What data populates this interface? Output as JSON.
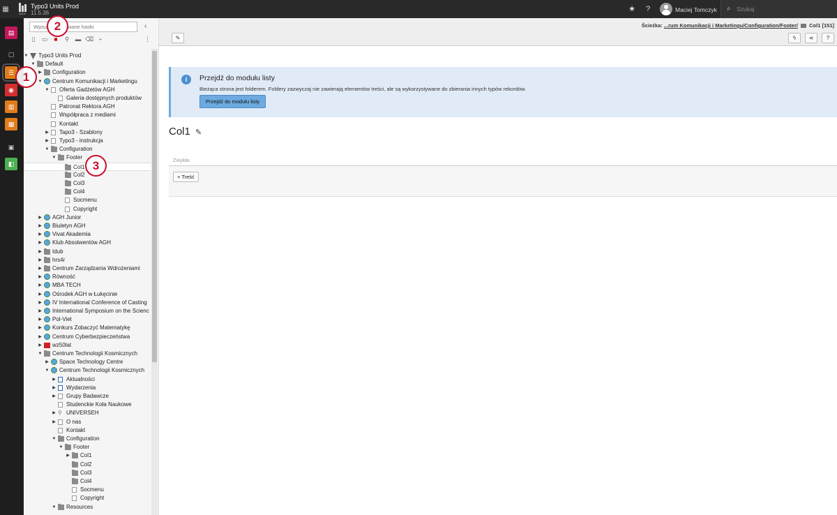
{
  "topbar": {
    "site_name": "Typo3 Units Prod",
    "site_version": "11.5.36",
    "logo_text": "AGH",
    "user_name": "Maciej Tomczyk",
    "search_placeholder": "Szukaj"
  },
  "modules": [
    {
      "name": "web-layout-module",
      "color": "#c2185b"
    },
    {
      "name": "page-module",
      "color": "transparent"
    },
    {
      "name": "list-module",
      "color": "#e07c1a"
    },
    {
      "name": "view-module",
      "color": "#d32f2f"
    },
    {
      "name": "info-module",
      "color": "#e07c1a"
    },
    {
      "name": "calendar-module",
      "color": "#e07c1a"
    },
    {
      "name": "filelist-module",
      "color": "transparent"
    },
    {
      "name": "extension-module",
      "color": "#4caf50"
    }
  ],
  "tree": {
    "filter_placeholder": "Wpisz wyszukiwane hasło",
    "nodes": [
      {
        "label": "Typo3 Units Prod",
        "indent": 0,
        "icon": "root",
        "toggle": "▼"
      },
      {
        "label": "Default",
        "indent": 1,
        "icon": "folder",
        "toggle": "▼"
      },
      {
        "label": "Configuration",
        "indent": 2,
        "icon": "folder",
        "toggle": "▶"
      },
      {
        "label": "Centrum Komunikacji i Marketingu",
        "indent": 2,
        "icon": "site",
        "toggle": "▼"
      },
      {
        "label": "Oferta Gadżetów AGH",
        "indent": 3,
        "icon": "page",
        "toggle": "▼"
      },
      {
        "label": "Galeria dostępnych produktów",
        "indent": 4,
        "icon": "page",
        "toggle": ""
      },
      {
        "label": "Patronat Rektora AGH",
        "indent": 3,
        "icon": "page",
        "toggle": ""
      },
      {
        "label": "Współpraca z mediami",
        "indent": 3,
        "icon": "page",
        "toggle": ""
      },
      {
        "label": "Kontakt",
        "indent": 3,
        "icon": "page",
        "toggle": ""
      },
      {
        "label": "Tapo3 - Szablony",
        "indent": 3,
        "icon": "page",
        "toggle": "▶"
      },
      {
        "label": "Typo3 - instrukcja",
        "indent": 3,
        "icon": "page",
        "toggle": "▶"
      },
      {
        "label": "Configuration",
        "indent": 3,
        "icon": "folder",
        "toggle": "▼"
      },
      {
        "label": "Footer",
        "indent": 4,
        "icon": "folder",
        "toggle": "▼"
      },
      {
        "label": "Col1",
        "indent": 5,
        "icon": "folder",
        "toggle": "",
        "selected": true
      },
      {
        "label": "Col2",
        "indent": 5,
        "icon": "folder",
        "toggle": ""
      },
      {
        "label": "Col3",
        "indent": 5,
        "icon": "folder",
        "toggle": ""
      },
      {
        "label": "Col4",
        "indent": 5,
        "icon": "folder",
        "toggle": ""
      },
      {
        "label": "Socmenu",
        "indent": 5,
        "icon": "page",
        "toggle": ""
      },
      {
        "label": "Copyright",
        "indent": 5,
        "icon": "page",
        "toggle": ""
      },
      {
        "label": "AGH Junior",
        "indent": 2,
        "icon": "site",
        "toggle": "▶"
      },
      {
        "label": "Biuletyn AGH",
        "indent": 2,
        "icon": "site",
        "toggle": "▶"
      },
      {
        "label": "Vivat Akademia",
        "indent": 2,
        "icon": "site",
        "toggle": "▶"
      },
      {
        "label": "Klub Absolwentów AGH",
        "indent": 2,
        "icon": "site",
        "toggle": "▶"
      },
      {
        "label": "Idub",
        "indent": 2,
        "icon": "folder",
        "toggle": "▶"
      },
      {
        "label": "hrs4r",
        "indent": 2,
        "icon": "folder",
        "toggle": "▶"
      },
      {
        "label": "Centrum Zarządzania Wdrożeniami",
        "indent": 2,
        "icon": "folder",
        "toggle": "▶"
      },
      {
        "label": "Równość",
        "indent": 2,
        "icon": "site",
        "toggle": "▶"
      },
      {
        "label": "MBA TECH",
        "indent": 2,
        "icon": "site",
        "toggle": "▶"
      },
      {
        "label": "Ośrodek AGH w Łukęcinie",
        "indent": 2,
        "icon": "site",
        "toggle": "▶"
      },
      {
        "label": "IV International Conference of Casting",
        "indent": 2,
        "icon": "site",
        "toggle": "▶"
      },
      {
        "label": "International Symposium on the Scienc",
        "indent": 2,
        "icon": "site",
        "toggle": "▶"
      },
      {
        "label": "Pol-Viet",
        "indent": 2,
        "icon": "site",
        "toggle": "▶"
      },
      {
        "label": "Konkurs Zobaczyć Matematykę",
        "indent": 2,
        "icon": "site",
        "toggle": "▶"
      },
      {
        "label": "Centrum Cyberbezpieczeństwa",
        "indent": 2,
        "icon": "site",
        "toggle": "▶"
      },
      {
        "label": "wz50lat",
        "indent": 2,
        "icon": "special",
        "toggle": "▶"
      },
      {
        "label": "Centrum Technologii Kosmicznych",
        "indent": 2,
        "icon": "folder",
        "toggle": "▼"
      },
      {
        "label": "Space Technology Centre",
        "indent": 3,
        "icon": "site",
        "toggle": "▶"
      },
      {
        "label": "Centrum Technologii Kosmicznych",
        "indent": 3,
        "icon": "site",
        "toggle": "▼"
      },
      {
        "label": "Aktualności",
        "indent": 4,
        "icon": "blue",
        "toggle": "▶"
      },
      {
        "label": "Wydarzenia",
        "indent": 4,
        "icon": "blue",
        "toggle": "▶"
      },
      {
        "label": "Grupy Badawcze",
        "indent": 4,
        "icon": "page",
        "toggle": "▶"
      },
      {
        "label": "Studenckie Koła Naukowe",
        "indent": 4,
        "icon": "page",
        "toggle": ""
      },
      {
        "label": "UNIVERSEH",
        "indent": 4,
        "icon": "link",
        "toggle": "▶"
      },
      {
        "label": "O nas",
        "indent": 4,
        "icon": "page",
        "toggle": "▶"
      },
      {
        "label": "Kontakt",
        "indent": 4,
        "icon": "page",
        "toggle": ""
      },
      {
        "label": "Configuration",
        "indent": 4,
        "icon": "folder",
        "toggle": "▼"
      },
      {
        "label": "Footer",
        "indent": 5,
        "icon": "folder",
        "toggle": "▼"
      },
      {
        "label": "Col1",
        "indent": 6,
        "icon": "folder",
        "toggle": "▶"
      },
      {
        "label": "Col2",
        "indent": 6,
        "icon": "folder",
        "toggle": ""
      },
      {
        "label": "Col3",
        "indent": 6,
        "icon": "folder",
        "toggle": ""
      },
      {
        "label": "Col4",
        "indent": 6,
        "icon": "folder",
        "toggle": ""
      },
      {
        "label": "Socmenu",
        "indent": 6,
        "icon": "page",
        "toggle": ""
      },
      {
        "label": "Copyright",
        "indent": 6,
        "icon": "page",
        "toggle": ""
      },
      {
        "label": "Resources",
        "indent": 4,
        "icon": "folder",
        "toggle": "▼"
      }
    ]
  },
  "docheader": {
    "path_label": "Ścieżka:",
    "path_link": "...rum Komunikacji i Marketingu/Configuration/Footer/",
    "current_page": "Col1 [151]"
  },
  "infobox": {
    "icon": "i",
    "title": "Przejdź do modułu listy",
    "text": "Bieżąca strona jest folderem. Foldery zazwyczaj nie zawierają elementów treści, ale są wykorzystywane do zbierania innych typów rekordów.",
    "button_label": "Przejdź do modułu listy"
  },
  "page": {
    "title": "Col1",
    "column_label": "Zwykła",
    "add_content_label": "Treść"
  },
  "annotations": {
    "one": "1",
    "two": "2",
    "three": "3"
  }
}
